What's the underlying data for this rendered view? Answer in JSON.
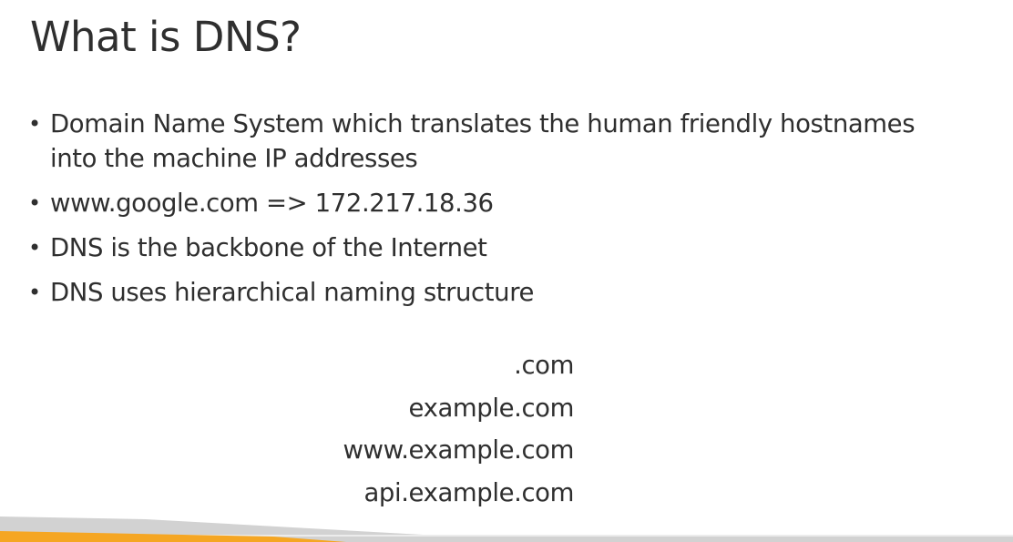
{
  "slide": {
    "title": "What is DNS?",
    "bullets": [
      "Domain Name System which translates the human friendly hostnames into the machine IP addresses",
      "www.google.com => 172.217.18.36",
      "DNS is the backbone of the Internet",
      "DNS uses hierarchical naming structure"
    ],
    "hierarchy": [
      ".com",
      "example.com",
      "www.example.com",
      "api.example.com"
    ]
  },
  "colors": {
    "text": "#2f2f2f",
    "accent_orange": "#f5a623",
    "accent_gray": "#c8c8c8"
  }
}
